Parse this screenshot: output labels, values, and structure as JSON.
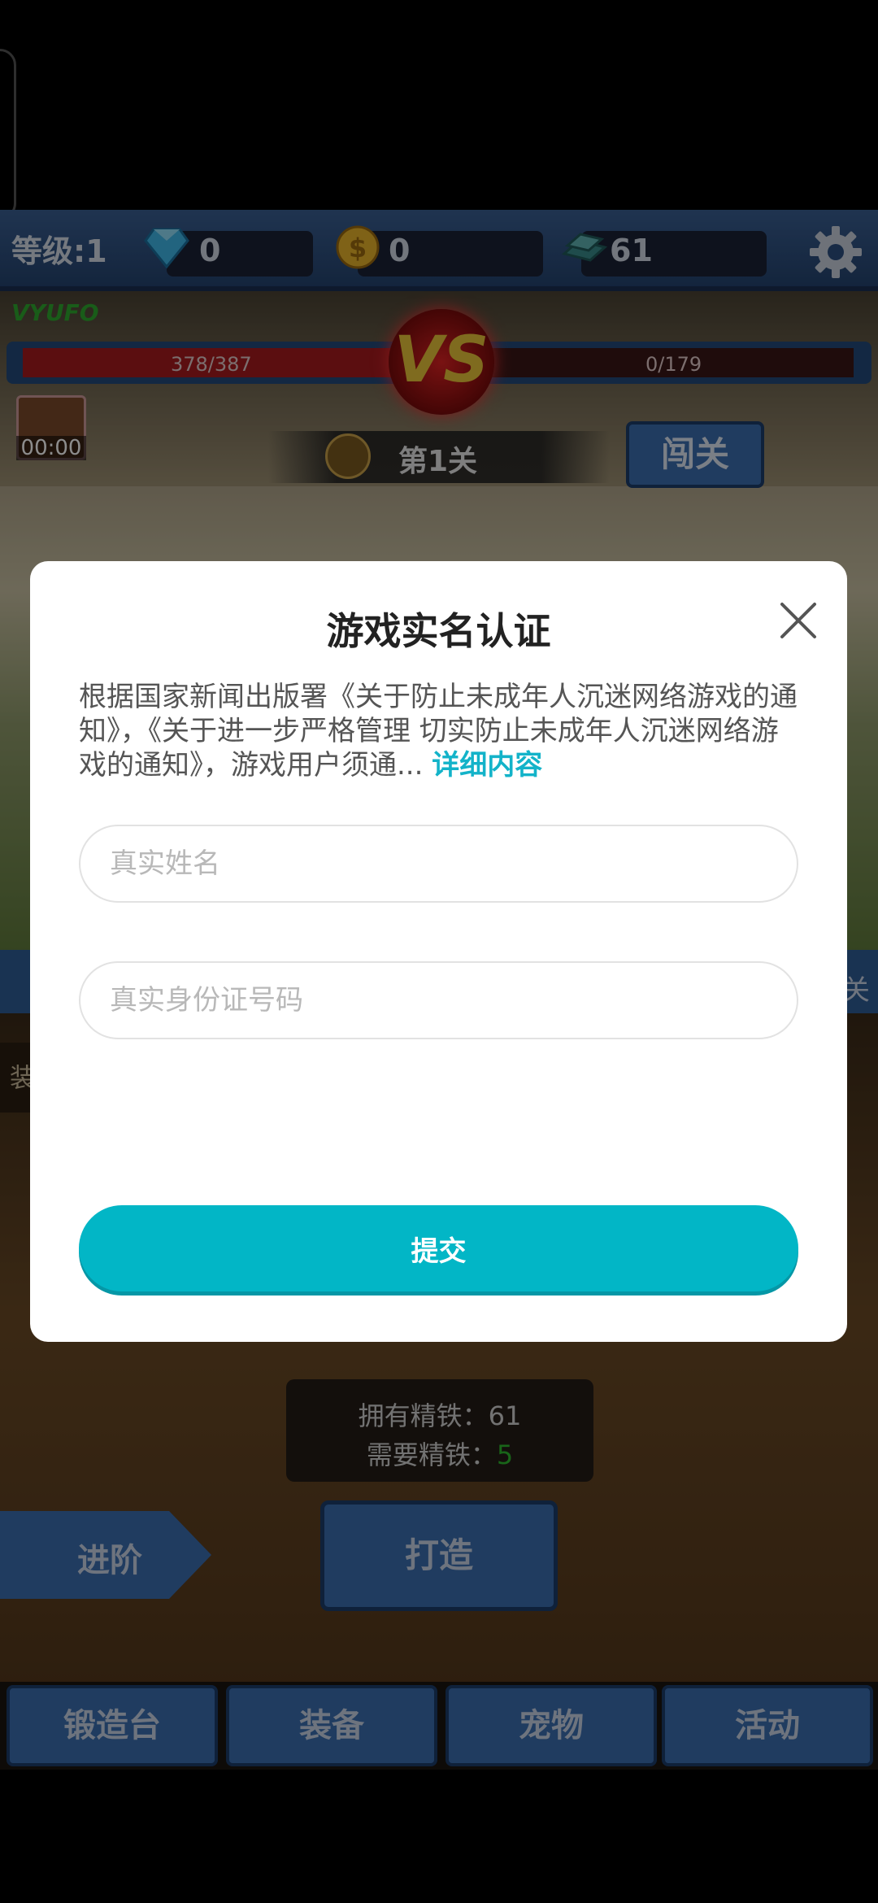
{
  "status": {
    "level": "等级:1",
    "diamonds": "0",
    "coins": "0",
    "iron": "61"
  },
  "battle": {
    "player_name": "VYUFO",
    "player_hp": "378/387",
    "enemy_hp": "0/179",
    "vs": "VS",
    "timer": "00:00",
    "stage": "第1关",
    "challenge_label": "闯关"
  },
  "forge": {
    "side_tab": "装",
    "mid_right": "关",
    "owned_iron": "拥有精铁：61",
    "need_label": "需要精铁：",
    "need_value": "5",
    "advance_label": "进阶",
    "forge_label": "打造"
  },
  "nav": {
    "items": [
      "锻造台",
      "装备",
      "宠物",
      "活动"
    ]
  },
  "dialog": {
    "title": "游戏实名认证",
    "notice": "根据国家新闻出版署《关于防止未成年人沉迷网络游戏的通知》，《关于进一步严格管理 切实防止未成年人沉迷网络游戏的通知》，游戏用户须通... ",
    "detail_link": "详细内容",
    "name_placeholder": "真实姓名",
    "id_placeholder": "真实身份证号码",
    "submit_label": "提交"
  },
  "colors": {
    "accent": "#02b6c6",
    "link": "#13b3c9",
    "game_button": "#3b6db0"
  }
}
